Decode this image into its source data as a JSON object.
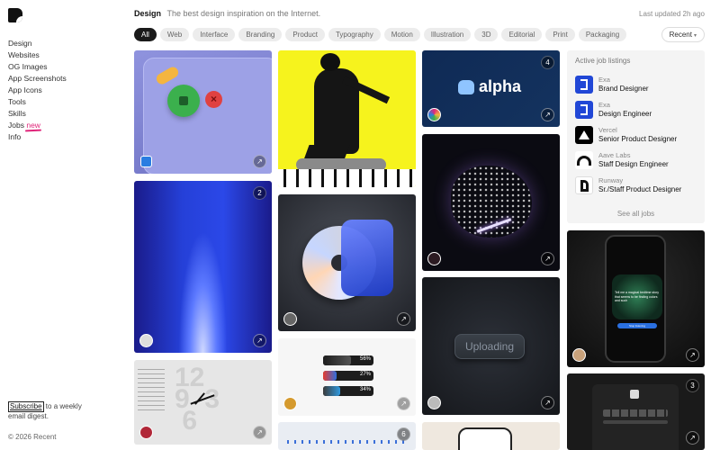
{
  "app": {
    "title": "Recent"
  },
  "sidebar": {
    "items": [
      {
        "label": "Design"
      },
      {
        "label": "Websites"
      },
      {
        "label": "OG Images"
      },
      {
        "label": "App Screenshots"
      },
      {
        "label": "App Icons"
      },
      {
        "label": "Tools"
      },
      {
        "label": "Skills"
      },
      {
        "label": "Jobs",
        "badge": "new"
      },
      {
        "label": "Info"
      }
    ]
  },
  "subscribe": {
    "button": "Subscribe",
    "text": " to a weekly email digest."
  },
  "footer": {
    "copyright": "© 2026 Recent"
  },
  "header": {
    "title": "Design",
    "subtitle": "The best design inspiration on the Internet.",
    "updated": "Last updated 2h ago"
  },
  "filters": [
    "All",
    "Web",
    "Interface",
    "Branding",
    "Product",
    "Typography",
    "Motion",
    "Illustration",
    "3D",
    "Editorial",
    "Print",
    "Packaging"
  ],
  "active_filter": "All",
  "sort": {
    "label": "Recent"
  },
  "cards": [
    {
      "name": "ui-blob-buttons"
    },
    {
      "name": "gradient-beam",
      "count": "2"
    },
    {
      "name": "clock-ui"
    },
    {
      "name": "skater-photo"
    },
    {
      "name": "music-cd-3d"
    },
    {
      "name": "progress-bars",
      "bars": [
        {
          "value": "56%"
        },
        {
          "value": "27%"
        },
        {
          "value": "34%"
        }
      ]
    },
    {
      "name": "timeline-ui",
      "count": "6"
    },
    {
      "name": "alpha-brand",
      "count": "4",
      "logo_text": "alpha"
    },
    {
      "name": "particle-sphere"
    },
    {
      "name": "uploading-button",
      "label": "Uploading"
    },
    {
      "name": "phone-shot"
    },
    {
      "name": "phone-ai",
      "prompt": "Tell me a magical bedtime story that seems to be finding colors and such",
      "button": "Stop listening"
    },
    {
      "name": "phone-dark",
      "count": "3"
    }
  ],
  "jobs": {
    "heading": "Active job listings",
    "items": [
      {
        "company": "Exa",
        "role": "Brand Designer"
      },
      {
        "company": "Exa",
        "role": "Design Engineer"
      },
      {
        "company": "Vercel",
        "role": "Senior Product Designer"
      },
      {
        "company": "Aave Labs",
        "role": "Staff Design Engineer"
      },
      {
        "company": "Runway",
        "role": "Sr./Staff Product Designer"
      }
    ],
    "see_all": "See all jobs"
  },
  "colors": {
    "accent": "#e0257a",
    "active_chip": "#1a1a1a",
    "chip": "#ececec"
  }
}
